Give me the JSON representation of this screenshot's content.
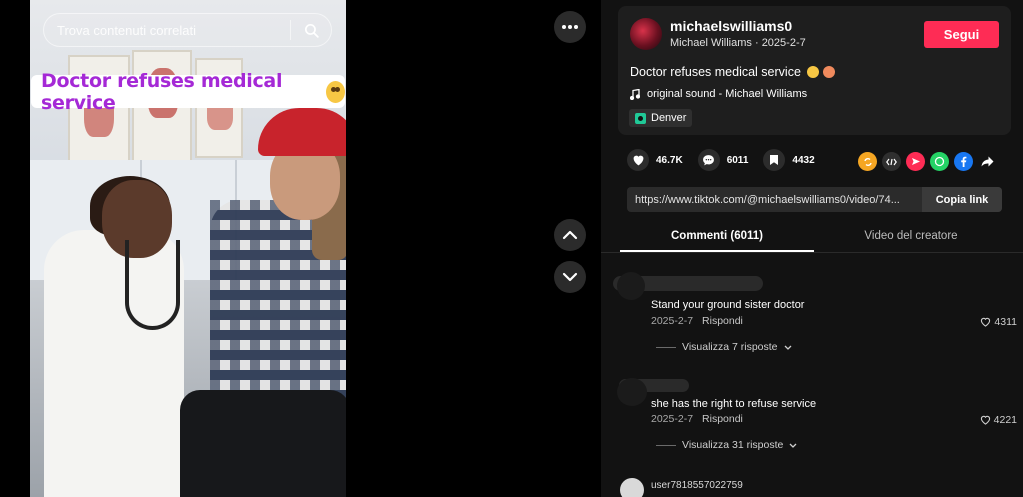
{
  "search": {
    "placeholder": "Trova contenuti correlati"
  },
  "video": {
    "caption": "Doctor refuses medical service"
  },
  "author": {
    "username": "michaelswilliams0",
    "display_name": "Michael Williams",
    "date": "2025-2-7",
    "separator": " · ",
    "follow_label": "Segui"
  },
  "post": {
    "description": "Doctor refuses medical service",
    "sound": "original sound - Michael Williams",
    "location": "Denver"
  },
  "stats": {
    "likes": "46.7K",
    "comments": "6011",
    "saves": "4432"
  },
  "link": {
    "url": "https://www.tiktok.com/@michaelswilliams0/video/74...",
    "copy_label": "Copia link"
  },
  "tabs": [
    {
      "label": "Commenti (6011)",
      "active": true
    },
    {
      "label": "Video del creatore",
      "active": false
    }
  ],
  "comments": [
    {
      "text": "Stand your ground sister doctor",
      "date": "2025-2-7",
      "reply_label": "Rispondi",
      "likes": "4311",
      "view_replies": "Visualizza 7 risposte"
    },
    {
      "text": "she has the right to refuse service",
      "date": "2025-2-7",
      "reply_label": "Rispondi",
      "likes": "4221",
      "view_replies": "Visualizza 31 risposte"
    },
    {
      "username": "user7818557022759"
    }
  ],
  "colors": {
    "follow": "#fe2c55",
    "caption": "#a529d6",
    "panel": "#121212"
  }
}
